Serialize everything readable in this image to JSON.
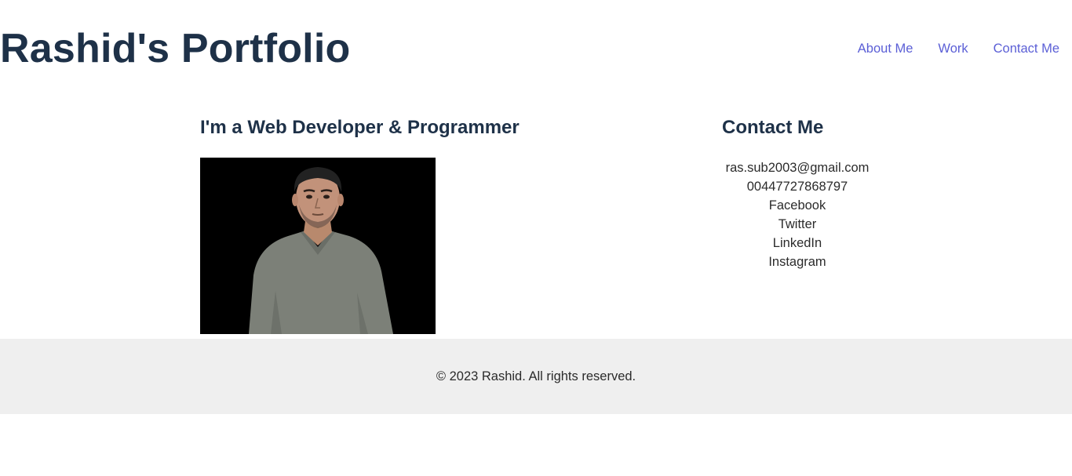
{
  "header": {
    "brand": "Rashid's Portfolio",
    "nav": [
      {
        "label": "About Me"
      },
      {
        "label": "Work"
      },
      {
        "label": "Contact Me"
      }
    ]
  },
  "intro": {
    "title": "I'm a Web Developer & Programmer",
    "portrait_description": "portrait photo of a man in a grey v-neck shirt on black background"
  },
  "contact": {
    "title": "Contact Me",
    "items": [
      {
        "label": "ras.sub2003@gmail.com"
      },
      {
        "label": "00447727868797"
      },
      {
        "label": "Facebook"
      },
      {
        "label": "Twitter"
      },
      {
        "label": "LinkedIn"
      },
      {
        "label": "Instagram"
      }
    ]
  },
  "footer": {
    "text": "© 2023 Rashid. All rights reserved."
  },
  "colors": {
    "heading": "#1e3148",
    "nav_link": "#5b5fd6",
    "footer_bg": "#efefef"
  }
}
